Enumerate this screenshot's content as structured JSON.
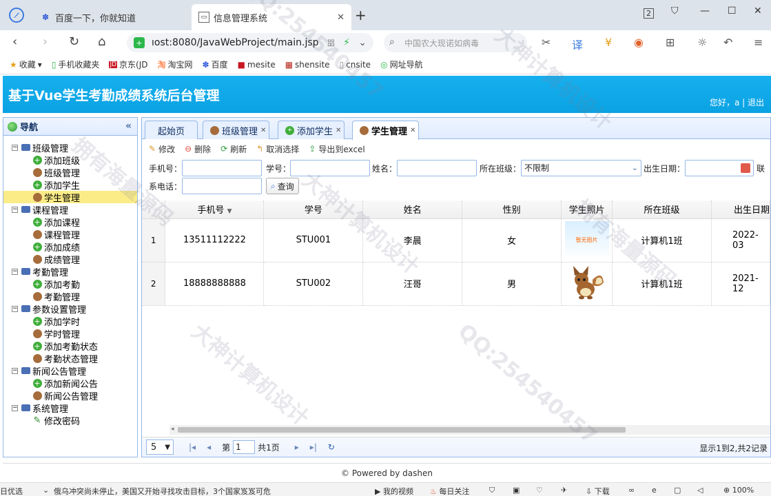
{
  "browser": {
    "tabs": [
      {
        "label": "百度一下，你就知道",
        "active": false
      },
      {
        "label": "信息管理系统",
        "active": true
      }
    ],
    "url": "ıost:8080/JavaWebProject/main.jsp",
    "search_placeholder": "中国农大现诺如病毒",
    "bookmarks": [
      "收藏",
      "手机收藏夹",
      "京东(JD",
      "淘宝网",
      "百度",
      "mesite",
      "shensite",
      "cnsite",
      "网址导航"
    ],
    "tab_count": "2"
  },
  "app": {
    "title": "基于Vue学生考勤成绩系统后台管理",
    "greeting": "您好，a",
    "logout": "退出"
  },
  "nav": {
    "title": "导航",
    "groups": [
      {
        "label": "班级管理",
        "items": [
          "添加班级",
          "班级管理"
        ]
      },
      {
        "label": null,
        "items": []
      }
    ]
  },
  "tree": [
    {
      "type": "group",
      "label": "班级管理"
    },
    {
      "type": "leaf",
      "icon": "add",
      "label": "添加班级"
    },
    {
      "type": "leaf",
      "icon": "user",
      "label": "班级管理"
    },
    {
      "type": "leaf",
      "icon": "add",
      "label": "添加学生"
    },
    {
      "type": "leaf",
      "icon": "user",
      "label": "学生管理",
      "selected": true
    },
    {
      "type": "group",
      "label": "课程管理"
    },
    {
      "type": "leaf",
      "icon": "add",
      "label": "添加课程"
    },
    {
      "type": "leaf",
      "icon": "user",
      "label": "课程管理"
    },
    {
      "type": "leaf",
      "icon": "add",
      "label": "添加成绩"
    },
    {
      "type": "leaf",
      "icon": "user",
      "label": "成绩管理"
    },
    {
      "type": "group",
      "label": "考勤管理"
    },
    {
      "type": "leaf",
      "icon": "add",
      "label": "添加考勤"
    },
    {
      "type": "leaf",
      "icon": "user",
      "label": "考勤管理"
    },
    {
      "type": "group",
      "label": "参数设置管理"
    },
    {
      "type": "leaf",
      "icon": "add",
      "label": "添加学时"
    },
    {
      "type": "leaf",
      "icon": "user",
      "label": "学时管理"
    },
    {
      "type": "leaf",
      "icon": "add",
      "label": "添加考勤状态"
    },
    {
      "type": "leaf",
      "icon": "user",
      "label": "考勤状态管理"
    },
    {
      "type": "group",
      "label": "新闻公告管理"
    },
    {
      "type": "leaf",
      "icon": "add",
      "label": "添加新闻公告"
    },
    {
      "type": "leaf",
      "icon": "user",
      "label": "新闻公告管理"
    },
    {
      "type": "group",
      "label": "系统管理"
    },
    {
      "type": "leaf",
      "icon": "pen",
      "label": "修改密码"
    }
  ],
  "panel_tabs": [
    {
      "label": "起始页",
      "closable": false,
      "active": false
    },
    {
      "label": "班级管理",
      "closable": true,
      "active": false
    },
    {
      "label": "添加学生",
      "closable": true,
      "active": false
    },
    {
      "label": "学生管理",
      "closable": true,
      "active": true
    }
  ],
  "actions": [
    "修改",
    "删除",
    "刷新",
    "取消选择",
    "导出到excel"
  ],
  "filters": {
    "phone_label": "手机号：",
    "stuno_label": "学号：",
    "name_label": "姓名：",
    "class_label": "所在班级：",
    "class_value": "不限制",
    "birth_label": "出生日期：",
    "contact_label_1": "联",
    "contact_label_2": "系电话：",
    "query_button": "查询"
  },
  "table": {
    "columns": [
      "手机号",
      "学号",
      "姓名",
      "性别",
      "学生照片",
      "所在班级",
      "出生日期"
    ],
    "rows": [
      {
        "n": "1",
        "phone": "13511112222",
        "stuno": "STU001",
        "name": "李晨",
        "sex": "女",
        "photo": "暂无图片",
        "cls": "计算机1班",
        "birth": "2022-03"
      },
      {
        "n": "2",
        "phone": "18888888888",
        "stuno": "STU002",
        "name": "汪哥",
        "sex": "男",
        "photo": "",
        "cls": "计算机1班",
        "birth": "2021-12"
      }
    ]
  },
  "pager": {
    "page_size": "5",
    "page_prefix": "第",
    "page_value": "1",
    "page_total": "共1页",
    "info": "显示1到2,共2记录"
  },
  "footer": "© Powered by dashen",
  "statusbar": {
    "left": "日优选",
    "news": "俄乌冲突尚未停止，美国又开始寻找攻击目标，3个国家岌岌可危",
    "video": "我的视频",
    "follow": "每日关注",
    "download": "下载",
    "zoom": "100%"
  },
  "watermarks": [
    "拥有海量源码",
    "大神计算机设计",
    "QQ:254540457"
  ],
  "colors": {
    "header": "#0aa2e2",
    "border": "#95b8e7",
    "selected": "#fbec88"
  }
}
